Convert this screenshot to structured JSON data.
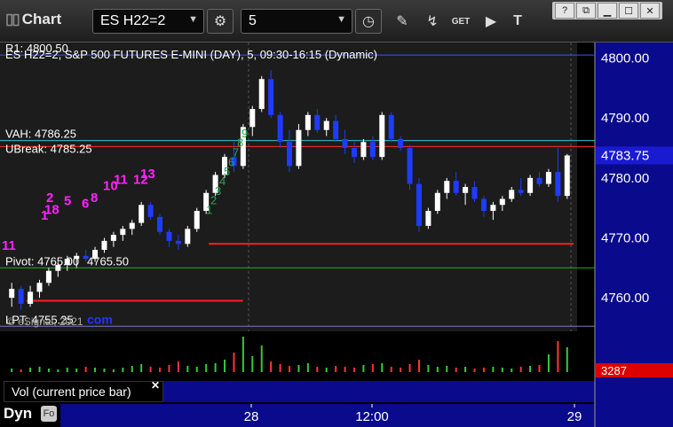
{
  "toolbar": {
    "title": "Chart",
    "symbol": "ES H22=2",
    "interval": "5",
    "get_label": "GET"
  },
  "window_buttons": [
    "?",
    "⧉",
    "▁",
    "☐",
    "✕"
  ],
  "chart_data": {
    "type": "candlestick",
    "title": "ES H22=2, S&P 500 FUTURES E-MINI (DAY), 5, 09:30-16:15 (Dynamic)",
    "ylim": [
      4755,
      4802
    ],
    "yticks": [
      4800.0,
      4790.0,
      4780.0,
      4770.0,
      4760.0
    ],
    "xticks": [
      "28",
      "12:00",
      "29"
    ],
    "last_price": 4783.75,
    "last_volume": 3287,
    "watermark": "© eSignal, 2021",
    "levels": [
      {
        "label": "R1: 4800.50",
        "value": 4800.5,
        "color": "#3355ff"
      },
      {
        "label": "VAH: 4786.25",
        "value": 4786.25,
        "color": "#2dc6c6"
      },
      {
        "label": "UBreak: 4785.25",
        "value": 4785.25,
        "color": "#ff2a2a"
      },
      {
        "label": "Pivot: 4765.00",
        "value": 4765.0,
        "color": "#22aa22"
      },
      {
        "label": "LPT: 4755.25",
        "value": 4755.25,
        "color": "#7777cc"
      }
    ],
    "support_lines": [
      {
        "value": 4769.0,
        "color": "#ff1e1e",
        "x_from": 0.36
      },
      {
        "value": 4759.5,
        "color": "#ff1e1e",
        "x_from": 0.04,
        "x_to": 0.42
      }
    ],
    "overlay_texts": [
      "4765.50",
      "com"
    ],
    "tdst_numbers": [
      "11",
      "1",
      "2",
      "18",
      "5",
      "6",
      "8",
      "10",
      "11",
      "12",
      "13"
    ],
    "candles": [
      [
        4760,
        4762.5,
        4758.5,
        4761.5
      ],
      [
        4761.5,
        4762,
        4758,
        4759
      ],
      [
        4759,
        4762,
        4758.5,
        4761
      ],
      [
        4761,
        4763,
        4760,
        4762.5
      ],
      [
        4762.5,
        4765,
        4762,
        4764.5
      ],
      [
        4764.5,
        4766,
        4763.5,
        4765.5
      ],
      [
        4765.5,
        4767,
        4764.5,
        4766.5
      ],
      [
        4766.5,
        4767.5,
        4765,
        4767
      ],
      [
        4767,
        4768,
        4766,
        4766.5
      ],
      [
        4766.5,
        4768.5,
        4766,
        4768
      ],
      [
        4768,
        4770,
        4767.5,
        4769.5
      ],
      [
        4769.5,
        4771,
        4768.5,
        4770.5
      ],
      [
        4770.5,
        4772,
        4769.5,
        4771.5
      ],
      [
        4771.5,
        4773,
        4770.5,
        4772.5
      ],
      [
        4772.5,
        4776,
        4772,
        4775.5
      ],
      [
        4775.5,
        4776,
        4773,
        4773.5
      ],
      [
        4773.5,
        4774,
        4770.5,
        4771
      ],
      [
        4771,
        4771.5,
        4768.5,
        4769.5
      ],
      [
        4769.5,
        4770.5,
        4768,
        4769
      ],
      [
        4769,
        4772,
        4768.5,
        4771.5
      ],
      [
        4771.5,
        4775,
        4771,
        4774.5
      ],
      [
        4774.5,
        4778,
        4774,
        4777.5
      ],
      [
        4777.5,
        4781,
        4777,
        4780.5
      ],
      [
        4780.5,
        4784,
        4780,
        4783.5
      ],
      [
        4783.5,
        4786,
        4781,
        4782
      ],
      [
        4782,
        4789,
        4781.5,
        4788.5
      ],
      [
        4788.5,
        4792,
        4787,
        4791.5
      ],
      [
        4791.5,
        4797,
        4791,
        4796.5
      ],
      [
        4796.5,
        4798,
        4790,
        4790.5
      ],
      [
        4790.5,
        4791,
        4785,
        4786
      ],
      [
        4786,
        4788,
        4781,
        4782
      ],
      [
        4782,
        4789,
        4781.5,
        4788
      ],
      [
        4788,
        4791,
        4787,
        4790.5
      ],
      [
        4790.5,
        4791.5,
        4787.5,
        4788
      ],
      [
        4788,
        4790,
        4787,
        4789.5
      ],
      [
        4789.5,
        4790.5,
        4786,
        4786.5
      ],
      [
        4786.5,
        4788,
        4784,
        4785
      ],
      [
        4785,
        4786,
        4782.5,
        4783.5
      ],
      [
        4783.5,
        4786.5,
        4783,
        4786
      ],
      [
        4786,
        4787,
        4783,
        4783.5
      ],
      [
        4783.5,
        4791,
        4783,
        4790.5
      ],
      [
        4790.5,
        4791,
        4786,
        4786.5
      ],
      [
        4786.5,
        4787,
        4784.5,
        4785
      ],
      [
        4785,
        4785.5,
        4778,
        4779
      ],
      [
        4779,
        4780,
        4771,
        4772
      ],
      [
        4772,
        4775,
        4771.5,
        4774.5
      ],
      [
        4774.5,
        4778,
        4774,
        4777.5
      ],
      [
        4777.5,
        4780,
        4776.5,
        4779.5
      ],
      [
        4779.5,
        4781,
        4777,
        4777.5
      ],
      [
        4777.5,
        4779,
        4775.5,
        4778.5
      ],
      [
        4778.5,
        4779.5,
        4776,
        4776.5
      ],
      [
        4776.5,
        4777,
        4773.5,
        4774.5
      ],
      [
        4774.5,
        4776,
        4773,
        4775.5
      ],
      [
        4775.5,
        4777,
        4774.5,
        4776.5
      ],
      [
        4776.5,
        4778.5,
        4776,
        4778
      ],
      [
        4778,
        4780,
        4777,
        4777.5
      ],
      [
        4777.5,
        4780.5,
        4777,
        4780
      ],
      [
        4780,
        4781,
        4778.5,
        4779
      ],
      [
        4779,
        4781.5,
        4778.5,
        4781
      ],
      [
        4781,
        4785,
        4776,
        4777
      ],
      [
        4777,
        4784,
        4776.5,
        4783.75
      ]
    ],
    "volumes": [
      4,
      3,
      5,
      6,
      4,
      3,
      5,
      4,
      6,
      5,
      4,
      3,
      5,
      7,
      9,
      6,
      5,
      8,
      12,
      7,
      6,
      9,
      10,
      14,
      22,
      40,
      18,
      30,
      12,
      9,
      7,
      8,
      10,
      6,
      5,
      7,
      6,
      5,
      8,
      9,
      10,
      6,
      5,
      9,
      14,
      8,
      6,
      7,
      5,
      6,
      4,
      5,
      6,
      5,
      4,
      6,
      7,
      8,
      20,
      35,
      28
    ]
  },
  "bottom": {
    "vol_label": "Vol (current price bar)",
    "close_glyph": "✕",
    "dyn_label": "Dyn",
    "dyn_icon": "Fo"
  }
}
